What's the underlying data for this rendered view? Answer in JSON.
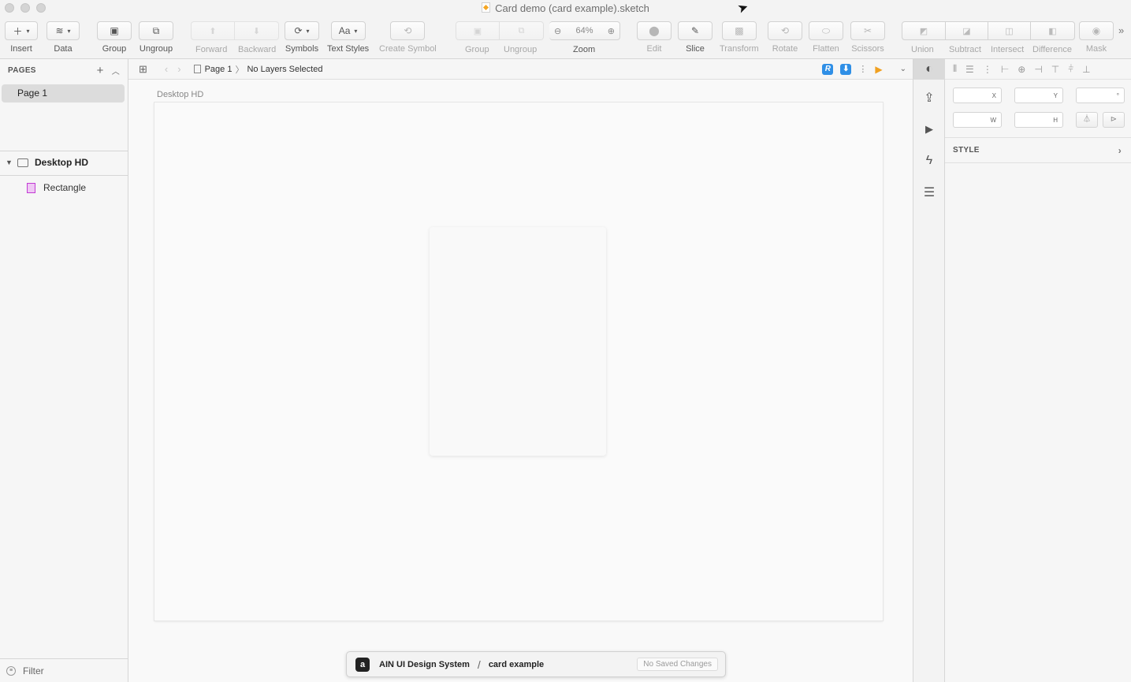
{
  "window": {
    "title": "Card demo (card example).sketch"
  },
  "toolbar": {
    "insert": "Insert",
    "data": "Data",
    "group": "Group",
    "ungroup": "Ungroup",
    "forward": "Forward",
    "backward": "Backward",
    "symbols": "Symbols",
    "text_styles": "Text Styles",
    "text_styles_glyph": "Aa",
    "create_symbol": "Create Symbol",
    "group2": "Group",
    "ungroup2": "Ungroup",
    "zoom_label": "Zoom",
    "zoom_value": "64%",
    "edit": "Edit",
    "slice": "Slice",
    "transform": "Transform",
    "rotate": "Rotate",
    "flatten": "Flatten",
    "scissors": "Scissors",
    "union": "Union",
    "subtract": "Subtract",
    "intersect": "Intersect",
    "difference": "Difference",
    "mask": "Mask"
  },
  "sidebar": {
    "pages_header": "PAGES",
    "pages": [
      {
        "label": "Page 1"
      }
    ],
    "layers": [
      {
        "label": "Desktop HD",
        "type": "artboard"
      },
      {
        "label": "Rectangle",
        "type": "rectangle"
      }
    ],
    "filter_label": "Filter"
  },
  "breadcrumb": {
    "page": "Page 1",
    "selection": "No Layers Selected"
  },
  "canvas": {
    "artboard_name": "Desktop HD"
  },
  "abstract_bar": {
    "project": "AIN UI Design System",
    "separator": "/",
    "branch": "card example",
    "status": "No Saved Changes"
  },
  "inspector": {
    "x_label": "X",
    "y_label": "Y",
    "rotation_label": "°",
    "w_label": "W",
    "h_label": "H",
    "style_header": "STYLE"
  },
  "colors": {
    "plugin_blue": "#2f8fe6",
    "rectangle_icon": "#c23bd4",
    "mirror_play": "#f0a020"
  }
}
